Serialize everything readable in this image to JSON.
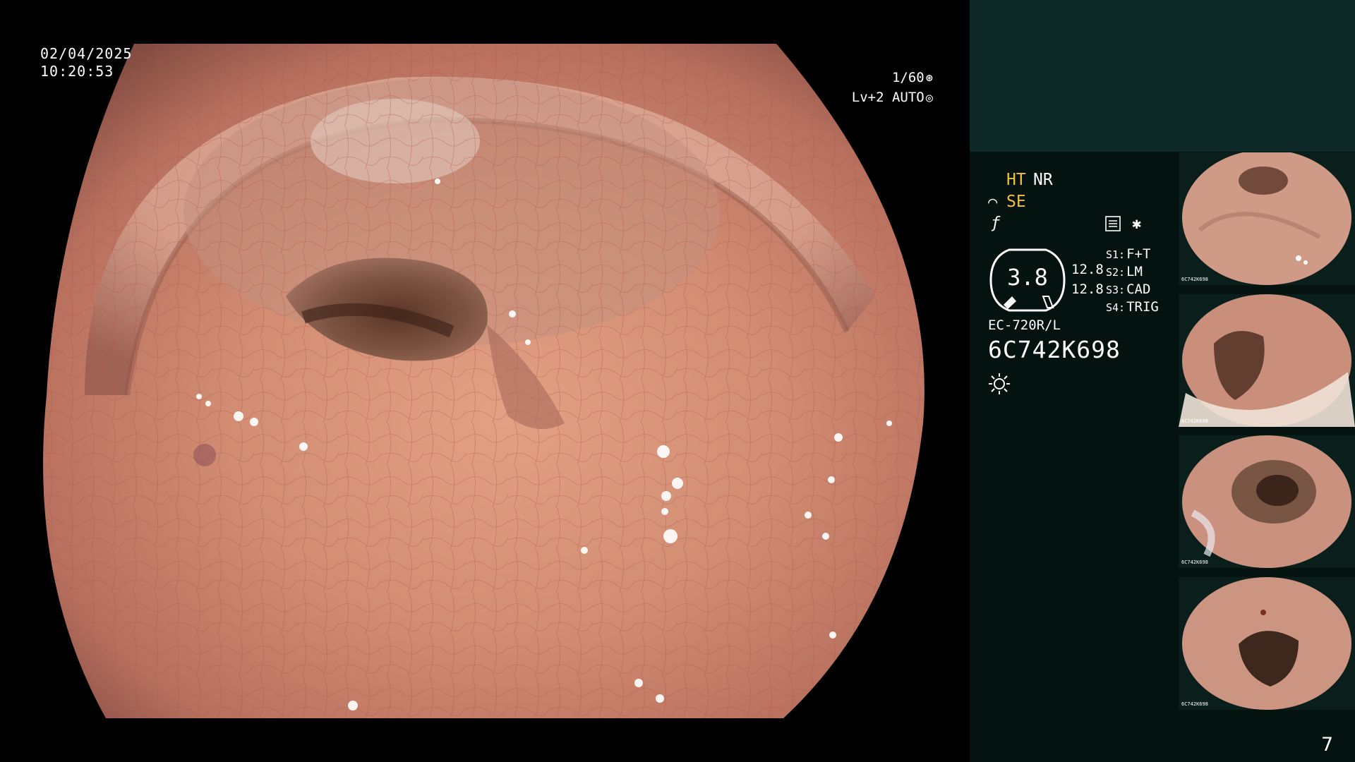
{
  "overlay": {
    "date": "02/04/2025",
    "time": "10:20:53",
    "shutter": "1/60",
    "shutter_icon": "shutter-icon",
    "iris": "Lv+2 AUTO",
    "iris_icon": "iris-icon"
  },
  "panel": {
    "ht": "HT",
    "nr": "NR",
    "se_icon": "structure-enhance-icon",
    "se": "SE",
    "f_icon": "freeze-icon",
    "mode_icon": "memory-mode-icon",
    "star": "✱",
    "gauge_value": "3.8",
    "value_1": "12.8",
    "value_2": "12.8",
    "switches": [
      {
        "key": "S1:",
        "value": "F+T"
      },
      {
        "key": "S2:",
        "value": "LM"
      },
      {
        "key": "S3:",
        "value": "CAD"
      },
      {
        "key": "S4:",
        "value": "TRIG"
      }
    ],
    "scope_model": "EC-720R/L",
    "scope_serial": "6C742K698",
    "light_icon": "light-source-icon",
    "page_number": "7"
  },
  "thumbnails": [
    {
      "serial": "6C742K698"
    },
    {
      "serial": "6C742K698"
    },
    {
      "serial": "6C742K698"
    },
    {
      "serial": "6C742K698"
    }
  ],
  "colors": {
    "accent_yellow": "#f5c13a",
    "panel_top": "#0d2826",
    "panel_body": "#041210",
    "mucosa": "#c9806a"
  }
}
